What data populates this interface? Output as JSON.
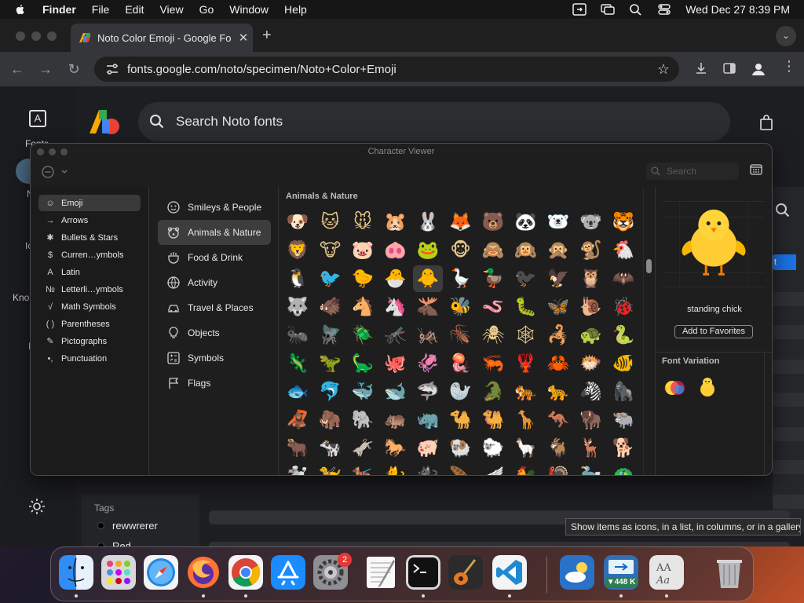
{
  "menubar": {
    "app_name": "Finder",
    "items": [
      "File",
      "Edit",
      "View",
      "Go",
      "Window",
      "Help"
    ],
    "datetime": "Wed Dec 27  8:39 PM"
  },
  "browser": {
    "tab_title": "Noto Color Emoji - Google Fo",
    "url": "fonts.google.com/noto/specimen/Noto+Color+Emoji",
    "tab_close": "✕",
    "new_tab": "+"
  },
  "gfonts": {
    "search_placeholder": "Search Noto fonts",
    "rail_fonts_label": "Fonts",
    "rail_fragments": [
      "N",
      "Ic",
      "Kno",
      "I"
    ],
    "blue_button_fragment": "t",
    "tags_header": "Tags",
    "tags": [
      {
        "label": "rewwrerer"
      },
      {
        "label": "Red"
      }
    ]
  },
  "character_viewer": {
    "title": "Character Viewer",
    "search_placeholder": "Search",
    "categories": [
      {
        "label": "Emoji",
        "glyph": "☺",
        "selected": true
      },
      {
        "label": "Arrows",
        "glyph": "→"
      },
      {
        "label": "Bullets & Stars",
        "glyph": "✱"
      },
      {
        "label": "Curren…ymbols",
        "glyph": "$"
      },
      {
        "label": "Latin",
        "glyph": "A"
      },
      {
        "label": "Letterli…ymbols",
        "glyph": "№"
      },
      {
        "label": "Math Symbols",
        "glyph": "√"
      },
      {
        "label": "Parentheses",
        "glyph": "( )"
      },
      {
        "label": "Pictographs",
        "glyph": "✎"
      },
      {
        "label": "Punctuation",
        "glyph": "•,"
      }
    ],
    "emoji_groups": [
      {
        "label": "Smileys & People"
      },
      {
        "label": "Animals & Nature",
        "selected": true
      },
      {
        "label": "Food & Drink"
      },
      {
        "label": "Activity"
      },
      {
        "label": "Travel & Places"
      },
      {
        "label": "Objects"
      },
      {
        "label": "Symbols"
      },
      {
        "label": "Flags"
      }
    ],
    "section_header": "Animals & Nature",
    "emoji_rows": [
      [
        "🐶",
        "🐱",
        "🐭",
        "🐹",
        "🐰",
        "🦊",
        "🐻",
        "🐼",
        "🐻‍❄️",
        "🐨",
        "🐯"
      ],
      [
        "🦁",
        "🐮",
        "🐷",
        "🐽",
        "🐸",
        "🐵",
        "🙈",
        "🙉",
        "🙊",
        "🐒",
        "🐔"
      ],
      [
        "🐧",
        "🐦",
        "🐤",
        "🐣",
        "🐥",
        "🪿",
        "🦆",
        "🐦‍⬛",
        "🦅",
        "🦉",
        "🦇"
      ],
      [
        "🐺",
        "🐗",
        "🐴",
        "🦄",
        "🫎",
        "🐝",
        "🪱",
        "🐛",
        "🦋",
        "🐌",
        "🐞"
      ],
      [
        "🐜",
        "🪰",
        "🪲",
        "🦟",
        "🦗",
        "🪳",
        "🕷",
        "🕸",
        "🦂",
        "🐢",
        "🐍"
      ],
      [
        "🦎",
        "🦖",
        "🦕",
        "🐙",
        "🦑",
        "🪼",
        "🦐",
        "🦞",
        "🦀",
        "🐡",
        "🐠"
      ],
      [
        "🐟",
        "🐬",
        "🐳",
        "🐋",
        "🦈",
        "🦭",
        "🐊",
        "🐅",
        "🐆",
        "🦓",
        "🦍"
      ],
      [
        "🦧",
        "🦣",
        "🐘",
        "🦛",
        "🦏",
        "🐪",
        "🐫",
        "🦒",
        "🦘",
        "🦬",
        "🐃"
      ],
      [
        "🐂",
        "🐄",
        "🫏",
        "🐎",
        "🐖",
        "🐏",
        "🐑",
        "🦙",
        "🐐",
        "🦌",
        "🐕"
      ],
      [
        "🐩",
        "🦮",
        "🐕‍🦺",
        "🐈",
        "🐈‍⬛",
        "🪶",
        "🪽",
        "🐓",
        "🦃",
        "🦤",
        "🦚"
      ]
    ],
    "selected_emoji": "🐥",
    "selected_name": "standing chick",
    "add_favorites": "Add to Favorites",
    "font_variation_header": "Font Variation",
    "variations": [
      "🐥",
      "🐥"
    ]
  },
  "tooltip": "Show items as icons, in a list, in columns, or in a gallery",
  "dock": {
    "apps": [
      {
        "name": "Finder"
      },
      {
        "name": "Launchpad"
      },
      {
        "name": "Safari"
      },
      {
        "name": "Firefox"
      },
      {
        "name": "Chrome"
      },
      {
        "name": "App Store"
      },
      {
        "name": "System Settings",
        "badge": "2"
      },
      {
        "name": "TextEdit"
      },
      {
        "name": "Terminal"
      },
      {
        "name": "GarageBand"
      },
      {
        "name": "Visual Studio Code"
      },
      {
        "name": "Weather"
      },
      {
        "name": "Network Monitor",
        "badge": "▼448 K"
      },
      {
        "name": "Font Book"
      },
      {
        "name": "Trash"
      }
    ]
  }
}
